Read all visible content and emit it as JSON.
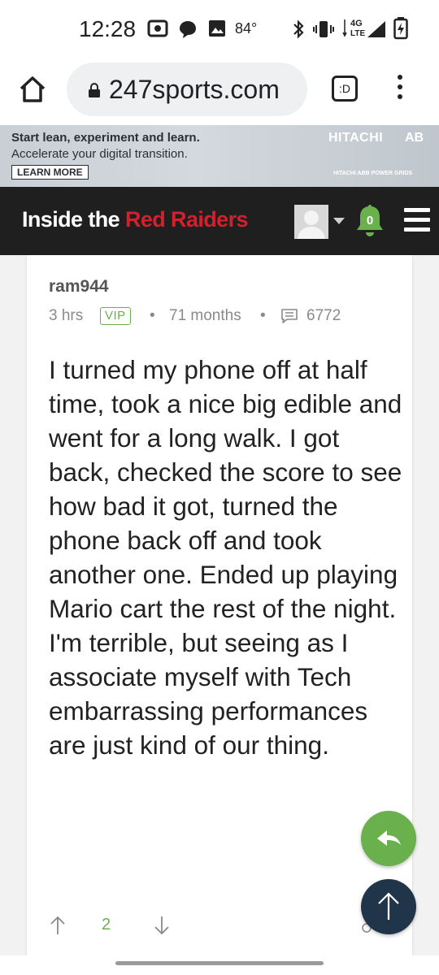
{
  "status_bar": {
    "time": "12:28",
    "temperature": "84°",
    "network": "4G LTE",
    "icons": [
      "radio-icon",
      "chat-bubble-icon",
      "image-icon",
      "bluetooth-icon",
      "vibrate-icon",
      "signal-icon",
      "battery-charging-icon"
    ]
  },
  "browser": {
    "url": "247sports.com",
    "tab_label": ":D",
    "icons": [
      "home-icon",
      "lock-icon",
      "menu-dots-icon"
    ]
  },
  "ad": {
    "headline": "Start lean, experiment and learn.",
    "subline": "Accelerate your digital transition.",
    "button": "LEARN MORE",
    "brand": "HITACHI",
    "brand_partial": "AB",
    "footer": "HITACHI ABB POWER GRIDS"
  },
  "site": {
    "title_white": "Inside the ",
    "title_red": "Red Raiders",
    "notification_count": "0",
    "colors": {
      "header_bg": "#1f1f1f",
      "accent_red": "#d3202d",
      "accent_green": "#6ab04c",
      "fab_dark": "#20344a"
    }
  },
  "post": {
    "username": "ram944",
    "time_ago": "3 hrs",
    "badge": "VIP",
    "separator": "•",
    "membership": "71 months",
    "post_count": "6772",
    "body": "I turned my phone off at half time, took a nice big edible and went for a long walk. I got back, checked the score to see how bad it got, turned the phone back off and took another one. Ended up playing Mario cart the rest of the night. I'm terrible, but seeing as I associate myself with Tech embarrassing performances are just kind of our thing.",
    "votes": "2"
  }
}
